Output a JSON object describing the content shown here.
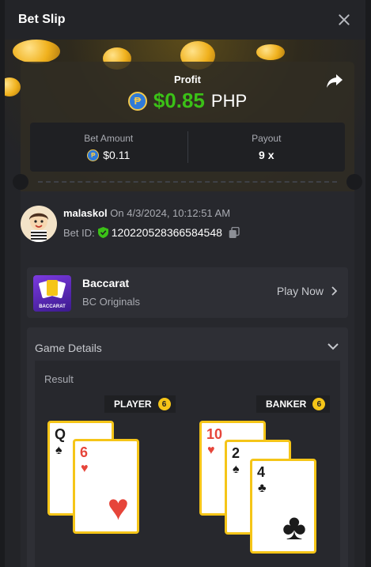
{
  "header": {
    "title": "Bet Slip"
  },
  "profit": {
    "label": "Profit",
    "coin": "₱",
    "value": "$0.85",
    "currency": "PHP",
    "value_color": "#3bc117"
  },
  "bet_amount": {
    "label": "Bet Amount",
    "value": "$0.11"
  },
  "payout": {
    "label": "Payout",
    "value": "9 x"
  },
  "user": {
    "name": "malaskol",
    "timestamp": "On 4/3/2024, 10:12:51 AM",
    "bet_id_label": "Bet ID:",
    "bet_id": "120220528366584548"
  },
  "game": {
    "name": "Baccarat",
    "provider": "BC Originals",
    "play_label": "Play Now",
    "thumb_text": "BACCARAT"
  },
  "details": {
    "title": "Game Details",
    "result_label": "Result"
  },
  "player": {
    "label": "PLAYER",
    "score": "6",
    "cards": [
      {
        "rank": "Q",
        "suit": "♠",
        "color": "black"
      },
      {
        "rank": "6",
        "suit": "♥",
        "color": "red"
      }
    ]
  },
  "banker": {
    "label": "BANKER",
    "score": "6",
    "cards": [
      {
        "rank": "10",
        "suit": "♥",
        "color": "red"
      },
      {
        "rank": "2",
        "suit": "♠",
        "color": "black"
      },
      {
        "rank": "4",
        "suit": "♣",
        "color": "black"
      }
    ]
  },
  "icons": [
    "close-icon",
    "share-icon",
    "coin-icon",
    "shield-check-icon",
    "copy-icon",
    "chevron-right-icon",
    "chevron-down-icon"
  ]
}
